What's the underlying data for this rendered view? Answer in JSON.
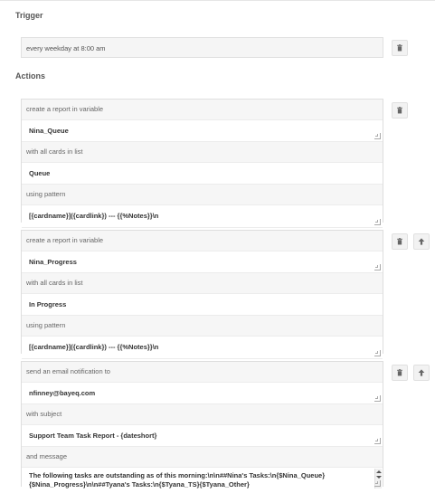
{
  "trigger": {
    "heading": "Trigger",
    "text": "every weekday at 8:00 am"
  },
  "actions": {
    "heading": "Actions",
    "items": [
      {
        "rows": [
          {
            "label": "create a report in variable",
            "value": "Nina_Queue"
          },
          {
            "label": "with all cards in list",
            "value": "Queue"
          },
          {
            "label": "using pattern",
            "value": "[{cardname}]({cardlink}) --- {{%Notes}}\\n"
          }
        ]
      },
      {
        "rows": [
          {
            "label": "create a report in variable",
            "value": "Nina_Progress"
          },
          {
            "label": "with all cards in list",
            "value": "In Progress"
          },
          {
            "label": "using pattern",
            "value": "[{cardname}]({cardlink}) --- {{%Notes}}\\n"
          }
        ]
      },
      {
        "rows": [
          {
            "label": "send an email notification to",
            "value": "nfinney@bayeq.com"
          },
          {
            "label": "with subject",
            "value": "Support Team Task Report - {dateshort}"
          }
        ],
        "message_label": "and message",
        "message_lines": [
          "The following tasks are outstanding as of this morning:\\n\\n##Nina's Tasks:\\n{$Nina_Queue}",
          "{$Nina_Progress}\\n\\n##Tyana's Tasks:\\n{$Tyana_TS}{$Tyana_Other}"
        ]
      }
    ]
  },
  "icons": {
    "delete": "trash-icon",
    "move_up": "arrow-up-icon"
  }
}
